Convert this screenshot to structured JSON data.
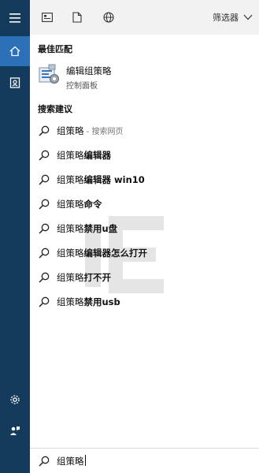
{
  "rail": {
    "items": [
      "menu-icon",
      "home-icon",
      "notebook-icon",
      "settings-icon",
      "feedback-icon"
    ],
    "colors": {
      "rail_bg": "#143a5c",
      "active_bg": "#2c71b8"
    }
  },
  "header": {
    "icons": [
      "document-view-icon",
      "document-icon",
      "web-globe-icon"
    ],
    "filter_label": "筛选器"
  },
  "best_match": {
    "section_label": "最佳匹配",
    "title": "编辑组策略",
    "subtitle": "控制面板",
    "icon": "group-policy-app-icon"
  },
  "suggestions": {
    "section_label": "搜索建议",
    "items": [
      {
        "prefix": "组策略",
        "suffix": "",
        "hint": " - 搜索网页"
      },
      {
        "prefix": "组策略",
        "suffix": "编辑器",
        "hint": ""
      },
      {
        "prefix": "组策略",
        "suffix": "编辑器 win10",
        "hint": ""
      },
      {
        "prefix": "组策略",
        "suffix": "命令",
        "hint": ""
      },
      {
        "prefix": "组策略",
        "suffix": "禁用u盘",
        "hint": ""
      },
      {
        "prefix": "组策略",
        "suffix": "编辑器怎么打开",
        "hint": ""
      },
      {
        "prefix": "组策略",
        "suffix": "打不开",
        "hint": ""
      },
      {
        "prefix": "组策略",
        "suffix": "禁用usb",
        "hint": ""
      }
    ]
  },
  "search": {
    "query": "组策略",
    "icon": "search-icon"
  }
}
